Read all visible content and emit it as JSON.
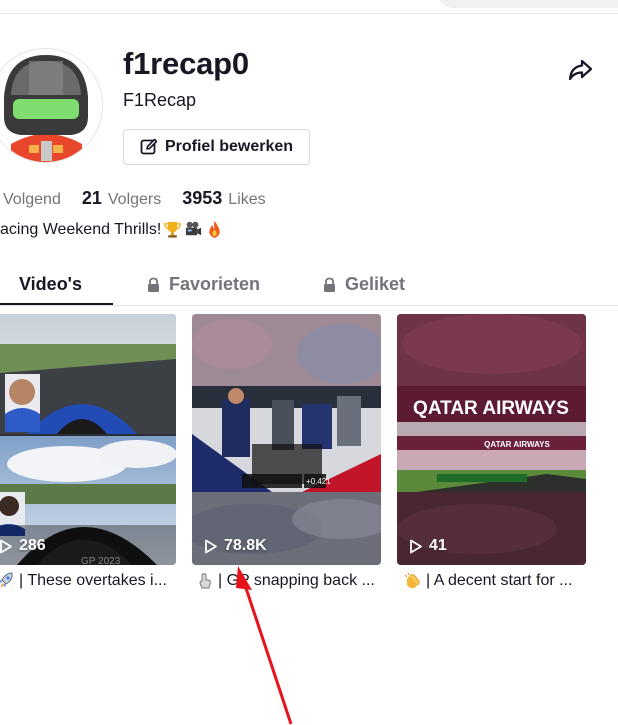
{
  "profile": {
    "username": "f1recap0",
    "nickname": "F1Recap",
    "edit_label": "Profiel bewerken",
    "stats": [
      {
        "value": "",
        "label": "Volgend"
      },
      {
        "value": "21",
        "label": "Volgers"
      },
      {
        "value": "3953",
        "label": "Likes"
      }
    ],
    "bio": "acing Weekend Thrills!"
  },
  "tabs": [
    {
      "label": "Video's",
      "active": true
    },
    {
      "label": "Favorieten",
      "active": false
    },
    {
      "label": "Geliket",
      "active": false
    }
  ],
  "videos": [
    {
      "views": "286",
      "caption": "| These overtakes i...",
      "overlay_text": "GP 2023"
    },
    {
      "views": "78.8K",
      "caption": "| GP snapping back ...",
      "overlay_text": "+0.421"
    },
    {
      "views": "41",
      "caption": "| A decent start for ...",
      "overlay_text": "QATAR AIRWAYS",
      "overlay_text_small": "QATAR AIRWAYS"
    }
  ],
  "colors": {
    "accent": "#161823",
    "muted": "#73747b",
    "annotation": "#e8131a"
  },
  "icons": [
    "share-icon",
    "edit-icon",
    "lock-icon",
    "play-icon"
  ]
}
